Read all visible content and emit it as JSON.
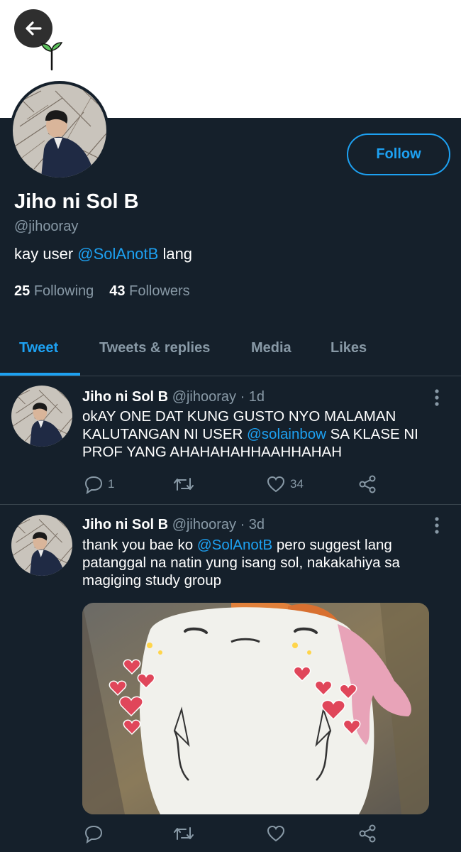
{
  "profile": {
    "display_name": "Jiho ni Sol B",
    "handle": "@jihooray",
    "bio_prefix": "kay user ",
    "bio_mention": "@SolAnotB",
    "bio_suffix": " lang",
    "following_count": "25",
    "following_label": "Following",
    "followers_count": "43",
    "followers_label": "Followers",
    "follow_label": "Follow"
  },
  "tabs": [
    {
      "label": "Tweet",
      "active": true
    },
    {
      "label": "Tweets & replies",
      "active": false
    },
    {
      "label": "Media",
      "active": false
    },
    {
      "label": "Likes",
      "active": false
    }
  ],
  "tweets": [
    {
      "name": "Jiho ni Sol B",
      "meta": "@jihooray · 1d",
      "text_line1": "okAY ONE DAT KUNG GUSTO NYO MALAMAN",
      "text_line2_prefix": "KALUTANGAN NI USER ",
      "text_line2_mention": "@solainbow",
      "text_line2_suffix": " SA KLASE NI",
      "text_line3": "PROF YANG AHAHAHAHHAAHHAHAH",
      "reply_count": "1",
      "retweet_count": "",
      "like_count": "34"
    },
    {
      "name": "Jiho ni Sol B",
      "meta": "@jihooray · 3d",
      "text_line1_prefix": "thank you bae ko ",
      "text_line1_mention": "@SolAnotB",
      "text_line1_suffix": " pero suggest lang",
      "text_line2": "patanggal na natin yung isang sol, nakakahiya sa",
      "text_line3": "magiging study group",
      "reply_count": "",
      "retweet_count": "",
      "like_count": ""
    }
  ],
  "colors": {
    "background": "#15202b",
    "accent": "#1da1f2",
    "muted": "#8899a6",
    "divider": "#38444d"
  },
  "icons": [
    "back-arrow-icon",
    "sprout-icon",
    "more-vertical-icon",
    "reply-icon",
    "retweet-icon",
    "like-icon",
    "share-icon"
  ]
}
